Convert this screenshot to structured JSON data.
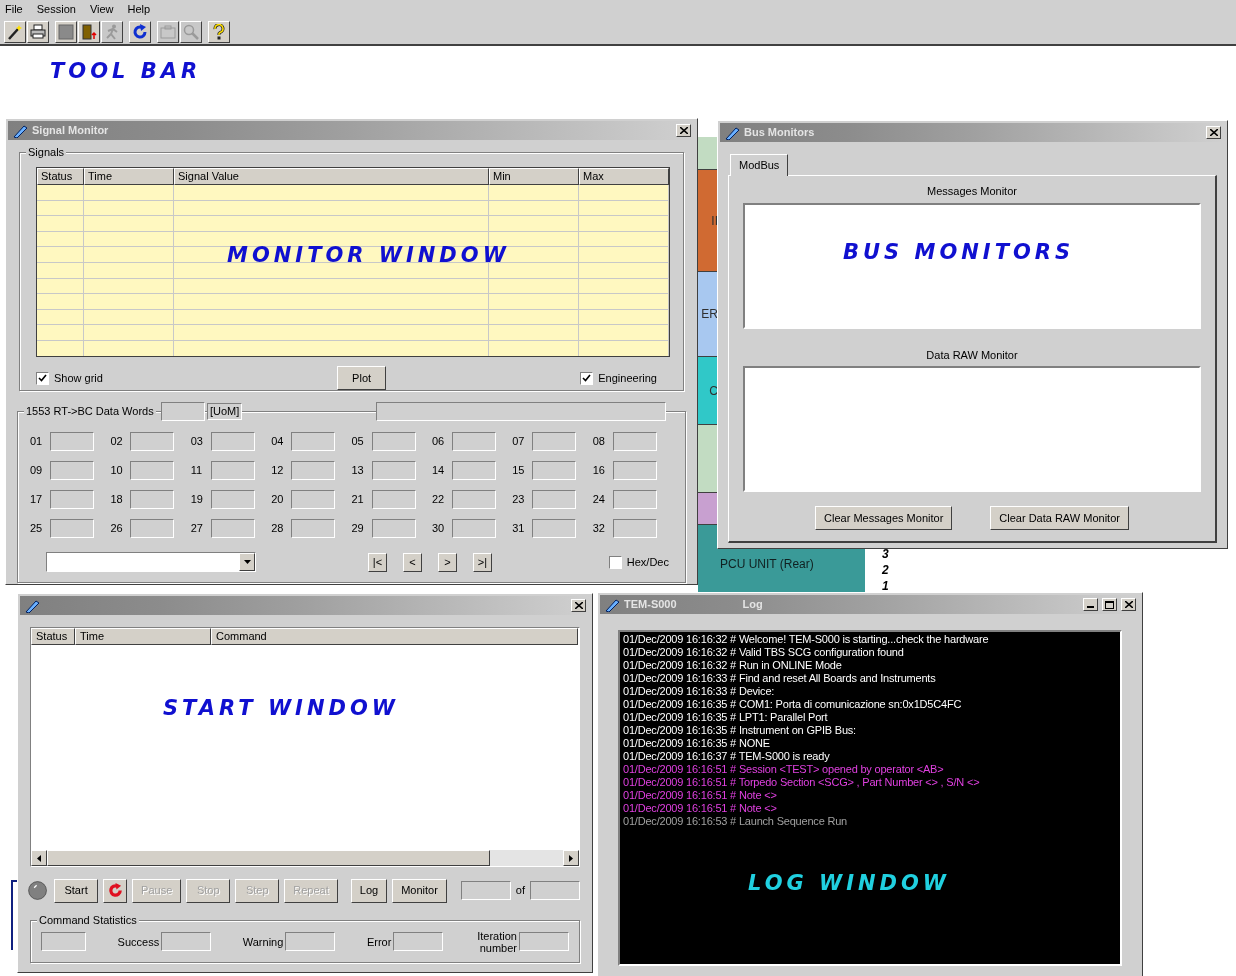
{
  "menu": [
    {
      "label": "File"
    },
    {
      "label": "Session"
    },
    {
      "label": "View"
    },
    {
      "label": "Help"
    }
  ],
  "toolbar": [
    {
      "items": [
        {
          "kind": "wand",
          "disabled": false
        },
        {
          "kind": "printer",
          "disabled": false
        }
      ]
    },
    {
      "items": [
        {
          "kind": "square",
          "disabled": false
        },
        {
          "kind": "exit",
          "disabled": false
        },
        {
          "kind": "runner",
          "disabled": true
        }
      ]
    },
    {
      "items": [
        {
          "kind": "refresh",
          "disabled": false
        }
      ]
    },
    {
      "items": [
        {
          "kind": "clipboard",
          "disabled": true
        },
        {
          "kind": "magnifier",
          "disabled": true
        }
      ]
    },
    {
      "items": [
        {
          "kind": "help",
          "disabled": false
        }
      ]
    }
  ],
  "toolbar_caption": "TOOL BAR",
  "background": {
    "blocks": [
      {
        "color": "#c2dcc2"
      },
      {
        "label": "II",
        "color": "#d06a32"
      },
      {
        "label": "ER",
        "color": "#a8c8f0"
      },
      {
        "label": "C",
        "color": "#30c8c8"
      },
      {
        "color": "#c2dcc2"
      },
      {
        "color": "#c8a0d0"
      }
    ],
    "unit": "PCU UNIT (Rear)",
    "numbers": [
      "3",
      "2",
      "1"
    ]
  },
  "signal_monitor": {
    "title": "Signal Monitor",
    "group": "Signals",
    "columns": [
      "Status",
      "Time",
      "Signal Value",
      "Min",
      "Max"
    ],
    "caption": "MONITOR WINDOW",
    "show_grid": {
      "label": "Show grid",
      "checked": true
    },
    "plot": "Plot",
    "engineering": {
      "label": "Engineering",
      "checked": true
    },
    "words_legend": "1553 RT->BC Data Words",
    "uom": "[UoM]",
    "words": [
      "01",
      "02",
      "03",
      "04",
      "05",
      "06",
      "07",
      "08",
      "09",
      "10",
      "11",
      "12",
      "13",
      "14",
      "15",
      "16",
      "17",
      "18",
      "19",
      "20",
      "21",
      "22",
      "23",
      "24",
      "25",
      "26",
      "27",
      "28",
      "29",
      "30",
      "31",
      "32"
    ],
    "nav": [
      "|<",
      "<",
      ">",
      ">|"
    ],
    "hex_dec": {
      "label": "Hex/Dec",
      "checked": false
    }
  },
  "bus_monitors": {
    "title": "Bus Monitors",
    "tabs": [
      {
        "label": "ModBus",
        "selected": true
      }
    ],
    "messages_label": "Messages Monitor",
    "caption": "BUS MONITORS",
    "raw_label": "Data RAW Monitor",
    "buttons": [
      "Clear Messages Monitor",
      "Clear Data RAW Monitor"
    ]
  },
  "start_window": {
    "columns": [
      "Status",
      "Time",
      "Command"
    ],
    "caption": "START WINDOW",
    "buttons": [
      {
        "kind": "text",
        "label": "Start",
        "disabled": false
      },
      {
        "kind": "refresh",
        "disabled": false
      },
      {
        "kind": "text",
        "label": "Pause",
        "disabled": true
      },
      {
        "kind": "text",
        "label": "Stop",
        "disabled": true
      },
      {
        "kind": "text",
        "label": "Step",
        "disabled": true
      },
      {
        "kind": "text",
        "label": "Repeat",
        "disabled": true
      }
    ],
    "log_button": "Log",
    "monitor_button": "Monitor",
    "of": "of",
    "stats_legend": "Command Statistics",
    "stats": [
      "Success",
      "Warning",
      "Error",
      "Iteration number"
    ]
  },
  "log_window": {
    "title": "TEM-S000",
    "subtitle": "Log",
    "caption": "LOG WINDOW",
    "lines": [
      {
        "text": "01/Dec/2009 16:16:32 # Welcome! TEM-S000 is starting...check the hardware",
        "color": "#ffffff"
      },
      {
        "text": "01/Dec/2009 16:16:32 # Valid TBS SCG configuration found",
        "color": "#ffffff"
      },
      {
        "text": "01/Dec/2009 16:16:32 # Run in ONLINE Mode",
        "color": "#ffffff"
      },
      {
        "text": "01/Dec/2009 16:16:33 # Find and reset All Boards and Instruments",
        "color": "#ffffff"
      },
      {
        "text": "01/Dec/2009 16:16:33 # Device:",
        "color": "#ffffff"
      },
      {
        "text": "01/Dec/2009 16:16:35 # COM1: Porta di comunicazione  sn:0x1D5C4FC",
        "color": "#ffffff"
      },
      {
        "text": "01/Dec/2009 16:16:35 # LPT1: Parallel Port",
        "color": "#ffffff"
      },
      {
        "text": "01/Dec/2009 16:16:35 # Instrument on GPIB Bus:",
        "color": "#ffffff"
      },
      {
        "text": "01/Dec/2009 16:16:35 # NONE",
        "color": "#ffffff"
      },
      {
        "text": "01/Dec/2009 16:16:37 # TEM-S000 is ready",
        "color": "#ffffff"
      },
      {
        "text": "01/Dec/2009 16:16:51 # Session <TEST> opened by operator <AB>",
        "color": "#e040e0"
      },
      {
        "text": "01/Dec/2009 16:16:51 # Torpedo Section <SCG> , Part Number <> , S/N <>",
        "color": "#e040e0"
      },
      {
        "text": "01/Dec/2009 16:16:51 # Note <>",
        "color": "#e040e0"
      },
      {
        "text": "01/Dec/2009 16:16:51 # Note <>",
        "color": "#e040e0"
      },
      {
        "text": "01/Dec/2009 16:16:53 # Launch Sequence Run",
        "color": "#a0a0a0"
      }
    ]
  }
}
